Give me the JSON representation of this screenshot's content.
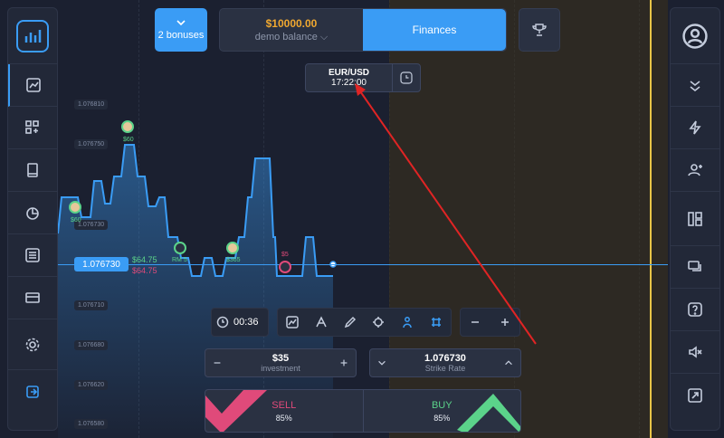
{
  "header": {
    "bonuses_label": "2 bonuses",
    "balance_amount": "$10000.00",
    "balance_label": "demo balance",
    "finances_label": "Finances"
  },
  "asset": {
    "name": "EUR/USD",
    "time": "17:22:00"
  },
  "chart": {
    "current_price": "1.076730",
    "change_pos": "$64.75",
    "change_neg": "$64.75",
    "price_ticks": [
      "1.076810",
      "1.076750",
      "1.076730",
      "1.076710",
      "1.076680",
      "1.076620",
      "1.076580"
    ],
    "trader_labels": [
      "$60",
      "$60",
      "RM 5",
      "$365",
      "$5"
    ]
  },
  "toolbar": {
    "timer": "00:36"
  },
  "investment": {
    "value": "$35",
    "label": "investment"
  },
  "strike": {
    "value": "1.076730",
    "label": "Strike Rate"
  },
  "trade": {
    "sell_label": "SELL",
    "sell_pct": "85%",
    "buy_label": "BUY",
    "buy_pct": "85%"
  },
  "colors": {
    "accent": "#3a9cf5",
    "sell": "#e04a7a",
    "buy": "#5bd38a",
    "expiry": "#e8c547",
    "balance": "#f0a830"
  }
}
